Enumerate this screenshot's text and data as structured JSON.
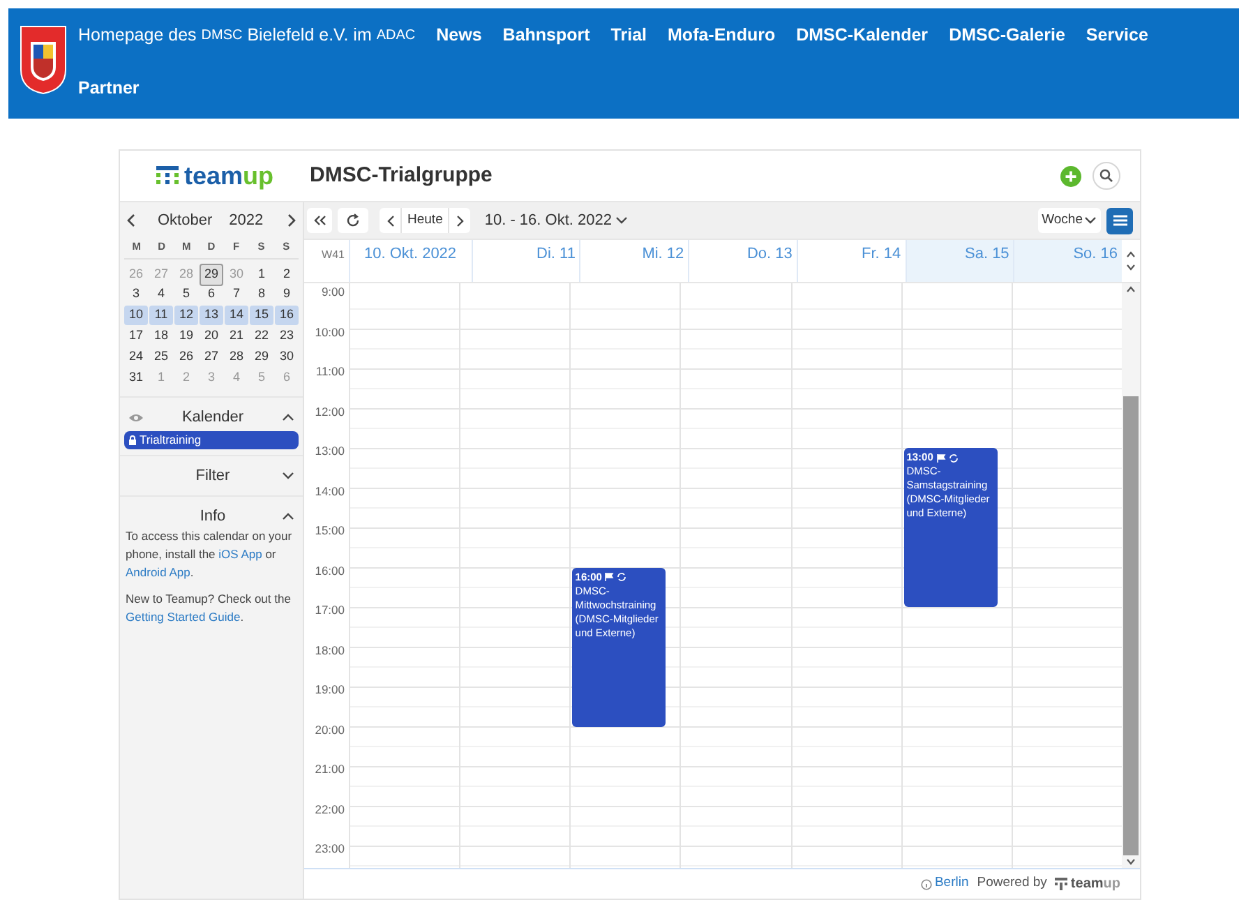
{
  "site_header": {
    "home_link": [
      {
        "text": "Homepage des ",
        "small": false
      },
      {
        "text": "DMSC",
        "small": true
      },
      {
        "text": " Bielefeld e.V. im ",
        "small": false
      },
      {
        "text": "ADAC",
        "small": true
      }
    ],
    "nav": [
      "News",
      "Bahnsport",
      "Trial",
      "Mofa-Enduro",
      "DMSC-Kalender",
      "DMSC-Galerie",
      "Service",
      "Partner"
    ]
  },
  "calendar_header": {
    "logo": [
      "team",
      "up"
    ],
    "title": "DMSC-Trialgruppe"
  },
  "mini_calendar": {
    "month": "Oktober",
    "year": "2022",
    "weekdays": [
      "M",
      "D",
      "M",
      "D",
      "F",
      "S",
      "S"
    ],
    "weeks": [
      [
        {
          "day": "26",
          "muted": true,
          "selected": false,
          "today": false
        },
        {
          "day": "27",
          "muted": true,
          "selected": false,
          "today": false
        },
        {
          "day": "28",
          "muted": true,
          "selected": false,
          "today": false
        },
        {
          "day": "29",
          "muted": false,
          "selected": false,
          "today": true
        },
        {
          "day": "30",
          "muted": true,
          "selected": false,
          "today": false
        },
        {
          "day": "1",
          "muted": false,
          "selected": false,
          "today": false
        },
        {
          "day": "2",
          "muted": false,
          "selected": false,
          "today": false
        }
      ],
      [
        {
          "day": "3",
          "muted": false,
          "selected": false,
          "today": false
        },
        {
          "day": "4",
          "muted": false,
          "selected": false,
          "today": false
        },
        {
          "day": "5",
          "muted": false,
          "selected": false,
          "today": false
        },
        {
          "day": "6",
          "muted": false,
          "selected": false,
          "today": false
        },
        {
          "day": "7",
          "muted": false,
          "selected": false,
          "today": false
        },
        {
          "day": "8",
          "muted": false,
          "selected": false,
          "today": false
        },
        {
          "day": "9",
          "muted": false,
          "selected": false,
          "today": false
        }
      ],
      [
        {
          "day": "10",
          "muted": false,
          "selected": true,
          "today": false
        },
        {
          "day": "11",
          "muted": false,
          "selected": true,
          "today": false
        },
        {
          "day": "12",
          "muted": false,
          "selected": true,
          "today": false
        },
        {
          "day": "13",
          "muted": false,
          "selected": true,
          "today": false
        },
        {
          "day": "14",
          "muted": false,
          "selected": true,
          "today": false
        },
        {
          "day": "15",
          "muted": false,
          "selected": true,
          "today": false
        },
        {
          "day": "16",
          "muted": false,
          "selected": true,
          "today": false
        }
      ],
      [
        {
          "day": "17",
          "muted": false,
          "selected": false,
          "today": false
        },
        {
          "day": "18",
          "muted": false,
          "selected": false,
          "today": false
        },
        {
          "day": "19",
          "muted": false,
          "selected": false,
          "today": false
        },
        {
          "day": "20",
          "muted": false,
          "selected": false,
          "today": false
        },
        {
          "day": "21",
          "muted": false,
          "selected": false,
          "today": false
        },
        {
          "day": "22",
          "muted": false,
          "selected": false,
          "today": false
        },
        {
          "day": "23",
          "muted": false,
          "selected": false,
          "today": false
        }
      ],
      [
        {
          "day": "24",
          "muted": false,
          "selected": false,
          "today": false
        },
        {
          "day": "25",
          "muted": false,
          "selected": false,
          "today": false
        },
        {
          "day": "26",
          "muted": false,
          "selected": false,
          "today": false
        },
        {
          "day": "27",
          "muted": false,
          "selected": false,
          "today": false
        },
        {
          "day": "28",
          "muted": false,
          "selected": false,
          "today": false
        },
        {
          "day": "29",
          "muted": false,
          "selected": false,
          "today": false
        },
        {
          "day": "30",
          "muted": false,
          "selected": false,
          "today": false
        }
      ],
      [
        {
          "day": "31",
          "muted": false,
          "selected": false,
          "today": false
        },
        {
          "day": "1",
          "muted": true,
          "selected": false,
          "today": false
        },
        {
          "day": "2",
          "muted": true,
          "selected": false,
          "today": false
        },
        {
          "day": "3",
          "muted": true,
          "selected": false,
          "today": false
        },
        {
          "day": "4",
          "muted": true,
          "selected": false,
          "today": false
        },
        {
          "day": "5",
          "muted": true,
          "selected": false,
          "today": false
        },
        {
          "day": "6",
          "muted": true,
          "selected": false,
          "today": false
        }
      ]
    ]
  },
  "sidebar_sections": [
    {
      "title": "Kalender",
      "expanded": true,
      "calendars": [
        {
          "name": "Trialtraining",
          "color": "#2c4fc0"
        }
      ]
    },
    {
      "title": "Filter",
      "expanded": false
    },
    {
      "title": "Info",
      "expanded": true,
      "paragraphs": [
        [
          {
            "text": "To access this calendar on your phone, install the ",
            "link": false
          },
          {
            "text": "iOS App",
            "link": true
          },
          {
            "text": " or ",
            "link": false
          },
          {
            "text": "Android App",
            "link": true
          },
          {
            "text": ".",
            "link": false
          }
        ],
        [
          {
            "text": "New to Teamup? Check out the ",
            "link": false
          },
          {
            "text": "Getting Started Guide",
            "link": true
          },
          {
            "text": ".",
            "link": false
          }
        ]
      ]
    }
  ],
  "toolbar": {
    "today_button": "Heute",
    "range": "10. - 16. Okt. 2022",
    "view": "Woche"
  },
  "week": {
    "week_label": "W41",
    "days": [
      {
        "label": "10. Okt. 2022",
        "weekend": false
      },
      {
        "label": "Di. 11",
        "weekend": false
      },
      {
        "label": "Mi. 12",
        "weekend": false,
        "events": [
          {
            "time": "16:00",
            "title": "DMSC-Mittwochstraining (DMSC-Mitglieder und Externe)",
            "color": "#2c4fc0"
          }
        ]
      },
      {
        "label": "Do. 13",
        "weekend": false
      },
      {
        "label": "Fr. 14",
        "weekend": false
      },
      {
        "label": "Sa. 15",
        "weekend": true,
        "events": [
          {
            "time": "13:00",
            "title": "DMSC-Samstagstraining (DMSC-Mitglieder und Externe)",
            "color": "#2c4fc0"
          }
        ]
      },
      {
        "label": "So. 16",
        "weekend": true
      }
    ],
    "hours": [
      "9:00",
      "10:00",
      "11:00",
      "12:00",
      "13:00",
      "14:00",
      "15:00",
      "16:00",
      "17:00",
      "18:00",
      "19:00",
      "20:00",
      "21:00",
      "22:00",
      "23:00"
    ]
  },
  "footer": {
    "timezone": "Berlin",
    "powered_by": "Powered by",
    "logo": [
      "team",
      "up"
    ]
  }
}
